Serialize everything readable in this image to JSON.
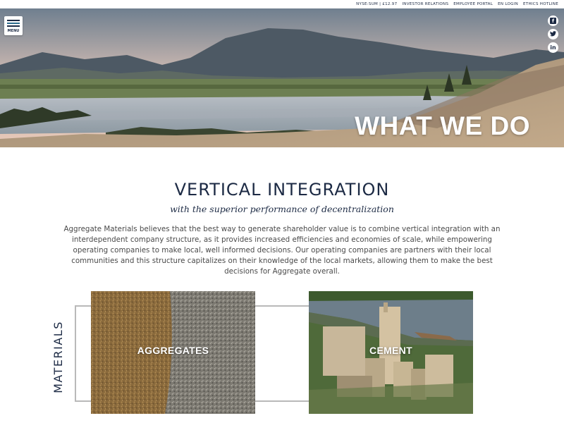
{
  "topbar": {
    "stock": "NYSE:SUM | £12.97",
    "links": [
      "INVESTOR RELATIONS",
      "EMPLOYEE PORTAL",
      "EN LOGIN",
      "ETHICS HOTLINE"
    ]
  },
  "menu": {
    "label": "MENU"
  },
  "social": {
    "facebook": "f",
    "twitter": "t",
    "linkedin": "in"
  },
  "hero": {
    "title": "WHAT WE DO"
  },
  "section": {
    "title": "VERTICAL INTEGRATION",
    "subtitle": "with the superior performance of decentralization",
    "body": "Aggregate Materials believes that the best way to generate shareholder value is to combine vertical integration with an interdependent company structure, as it provides increased efficiencies and economies of scale, while empowering operating companies to make local, well informed decisions. Our operating companies are partners with their local communities and this structure capitalizes on their knowledge of the local markets, allowing them to make the best decisions for Aggregate overall."
  },
  "materials": {
    "label": "MATERIALS",
    "tiles": [
      {
        "label": "AGGREGATES"
      },
      {
        "label": "CEMENT"
      }
    ]
  },
  "colors": {
    "navy": "#1c2a44",
    "text_gray": "#4a4a4a",
    "rule_gray": "#b9b9b9",
    "white": "#ffffff"
  }
}
